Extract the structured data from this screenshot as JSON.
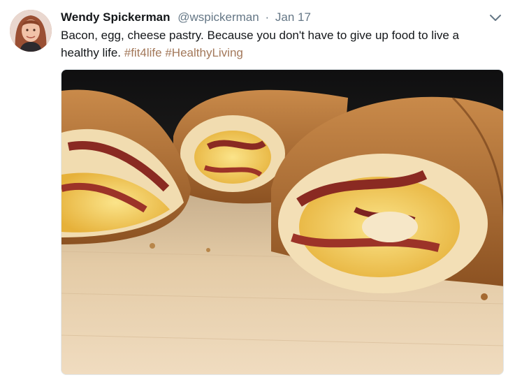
{
  "author": {
    "name": "Wendy Spickerman",
    "handle": "@wspickerman",
    "separator": "·",
    "date": "Jan 17"
  },
  "tweet": {
    "text": "Bacon, egg, cheese pastry. Because you don't have to give up food to live a healthy life.",
    "hashtags": [
      "#fit4life",
      "#HealthyLiving"
    ]
  },
  "icons": {
    "caret": "chevron-down-icon",
    "avatar": "avatar-photo",
    "media": "food-photo"
  },
  "colors": {
    "hashtag": "#a3785a",
    "secondary_text": "#657786",
    "primary_text": "#14171a"
  }
}
